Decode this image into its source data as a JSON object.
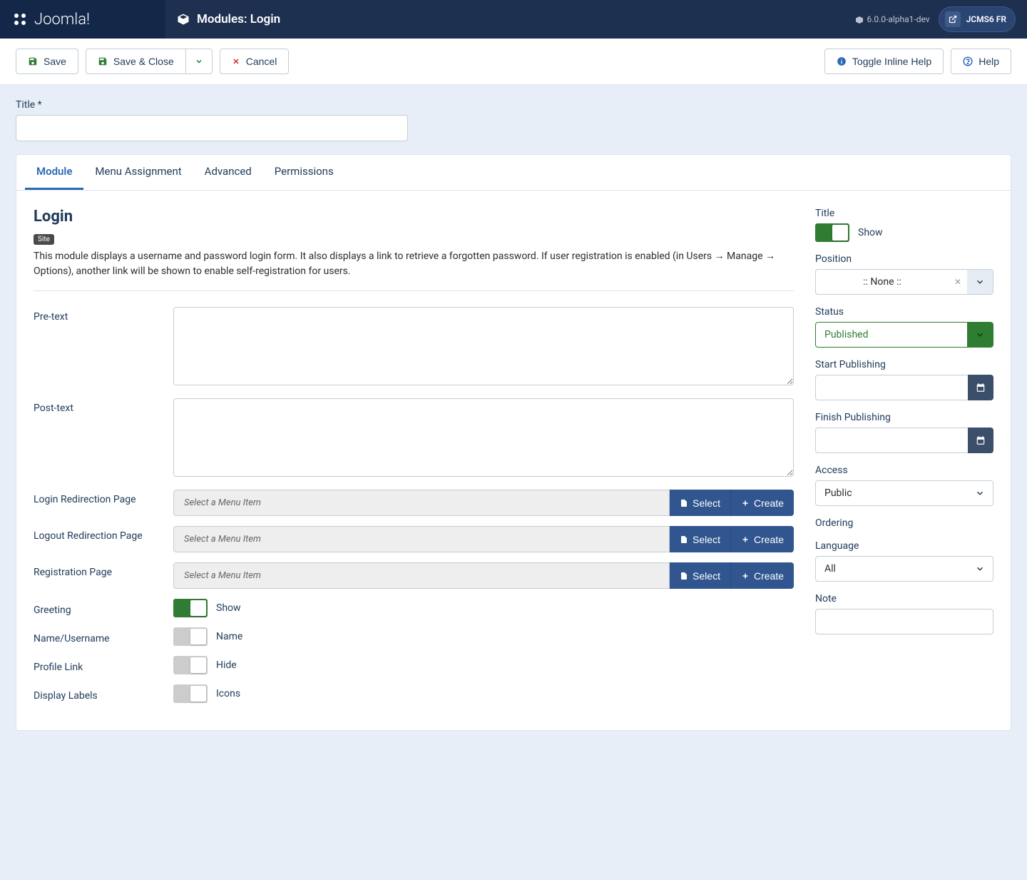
{
  "brand": "Joomla!",
  "page_title": "Modules: Login",
  "version": "6.0.0-alpha1-dev",
  "user": "JCMS6 FR",
  "toolbar": {
    "save": "Save",
    "save_close": "Save & Close",
    "cancel": "Cancel",
    "toggle_help": "Toggle Inline Help",
    "help": "Help"
  },
  "title_field": {
    "label": "Title *",
    "value": ""
  },
  "tabs": [
    "Module",
    "Menu Assignment",
    "Advanced",
    "Permissions"
  ],
  "module": {
    "heading": "Login",
    "badge": "Site",
    "description": "This module displays a username and password login form. It also displays a link to retrieve a forgotten password. If user registration is enabled (in Users → Manage → Options), another link will be shown to enable self-registration for users.",
    "fields": {
      "pretext": {
        "label": "Pre-text",
        "value": ""
      },
      "posttext": {
        "label": "Post-text",
        "value": ""
      },
      "login_redirect": {
        "label": "Login Redirection Page",
        "placeholder": "Select a Menu Item",
        "select_btn": "Select",
        "create_btn": "Create"
      },
      "logout_redirect": {
        "label": "Logout Redirection Page",
        "placeholder": "Select a Menu Item",
        "select_btn": "Select",
        "create_btn": "Create"
      },
      "registration_page": {
        "label": "Registration Page",
        "placeholder": "Select a Menu Item",
        "select_btn": "Select",
        "create_btn": "Create"
      },
      "greeting": {
        "label": "Greeting",
        "state": "Show"
      },
      "name_username": {
        "label": "Name/Username",
        "state": "Name"
      },
      "profile_link": {
        "label": "Profile Link",
        "state": "Hide"
      },
      "display_labels": {
        "label": "Display Labels",
        "state": "Icons"
      }
    }
  },
  "sidebar": {
    "title": {
      "label": "Title",
      "state": "Show"
    },
    "position": {
      "label": "Position",
      "value": ":: None ::"
    },
    "status": {
      "label": "Status",
      "value": "Published"
    },
    "start_publishing": {
      "label": "Start Publishing",
      "value": ""
    },
    "finish_publishing": {
      "label": "Finish Publishing",
      "value": ""
    },
    "access": {
      "label": "Access",
      "value": "Public"
    },
    "ordering": {
      "label": "Ordering"
    },
    "language": {
      "label": "Language",
      "value": "All"
    },
    "note": {
      "label": "Note",
      "value": ""
    }
  }
}
